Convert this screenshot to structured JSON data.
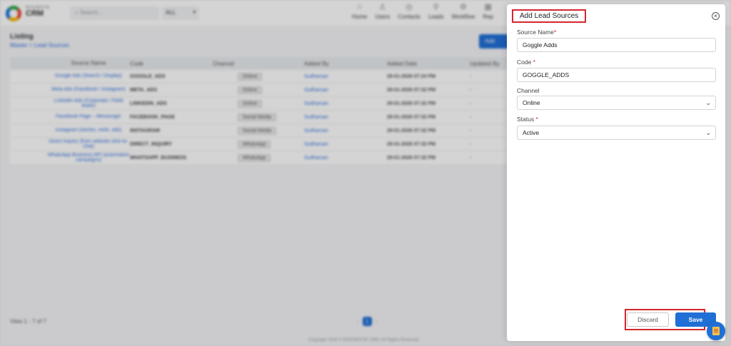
{
  "app": {
    "brand_small": "ROCHESTIE",
    "brand_big": "CRM",
    "search_placeholder": "Search...",
    "search_scope": "ALL",
    "nav": [
      "Home",
      "Users",
      "Contacts",
      "Leads",
      "Workflow",
      "Rep"
    ]
  },
  "listing": {
    "title": "Listing",
    "breadcrumb": "Master  >  Lead Sources",
    "add_button": "Add",
    "columns": [
      "",
      "Source Name",
      "Code",
      "Channel",
      "Added By",
      "Added Date",
      "Updated By"
    ],
    "rows": [
      {
        "name": "Google Ads (Search / Display)",
        "code": "GOOGLE_ADS",
        "channel": "Online",
        "added_by": "Sudharsan",
        "date": "29-01-2026 07:24 PM",
        "updated_by": "-"
      },
      {
        "name": "Meta Ads (Facebook / Instagram)",
        "code": "META_ADS",
        "channel": "Online",
        "added_by": "Sudharsan",
        "date": "29-01-2026 07:32 PM",
        "updated_by": "-"
      },
      {
        "name": "LinkedIn Ads (Corporate / Field leads)",
        "code": "LINKEDIN_ADS",
        "channel": "Online",
        "added_by": "Sudharsan",
        "date": "29-01-2026 07:32 PM",
        "updated_by": "-"
      },
      {
        "name": "Facebook Page – Messenger",
        "code": "FACEBOOK_PAGE",
        "channel": "Social Media",
        "added_by": "Sudharsan",
        "date": "29-01-2026 07:32 PM",
        "updated_by": "-"
      },
      {
        "name": "Instagram (stories, reels, ads)",
        "code": "INSTAGRAM",
        "channel": "Social Media",
        "added_by": "Sudharsan",
        "date": "29-01-2026 07:32 PM",
        "updated_by": "-"
      },
      {
        "name": "Direct Inquiry (from website click-to-chat)",
        "code": "DIRECT_INQUIRY",
        "channel": "WhatsApp",
        "added_by": "Sudharsan",
        "date": "29-01-2026 07:32 PM",
        "updated_by": "-"
      },
      {
        "name": "WhatsApp Business API (automation campaigns)",
        "code": "WHATSAPP_BUSINESS",
        "channel": "WhatsApp",
        "added_by": "Sudharsan",
        "date": "29-01-2026 07:32 PM",
        "updated_by": "-"
      }
    ],
    "pager_text": "View 1 - 7 of 7",
    "page": "1",
    "footer": "Copyright 2026 © ROCHESTIE CRM. All Rights Reserved."
  },
  "drawer": {
    "title": "Add Lead Sources",
    "close_icon": "close-circle-icon",
    "source_name_label": "Source Name",
    "source_name_value": "Goggle Adds",
    "code_label": "Code",
    "code_value": "GOGGLE_ADDS",
    "channel_label": "Channel",
    "channel_value": "Online",
    "status_label": "Status",
    "status_value": "Active",
    "required_mark": "*",
    "discard_label": "Discard",
    "save_label": "Save",
    "accent_color": "#1f6fd6",
    "highlight_color": "#d3262e"
  }
}
